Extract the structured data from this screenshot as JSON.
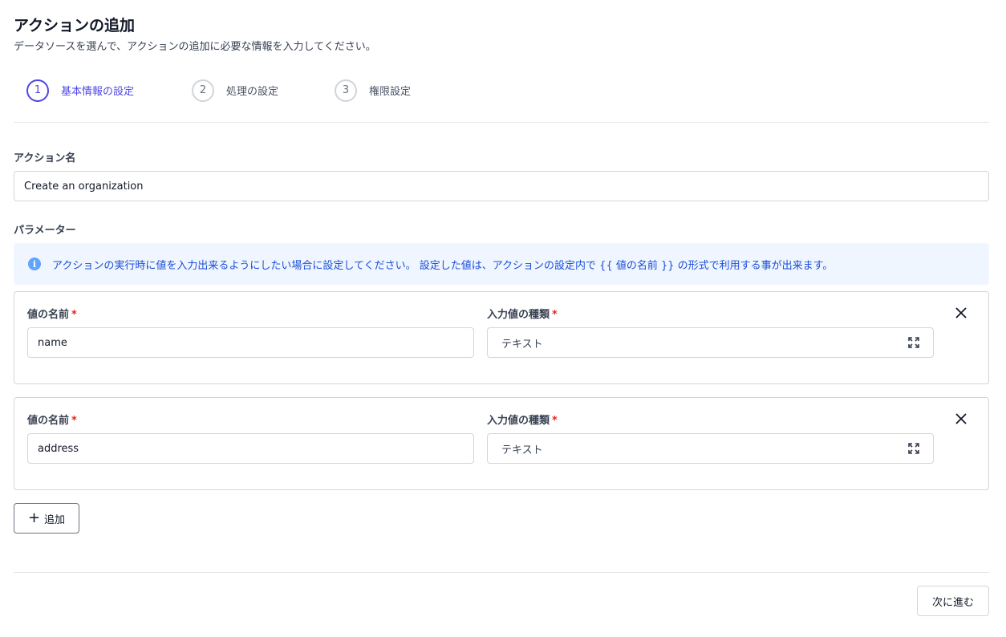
{
  "page": {
    "title": "アクションの追加",
    "subtitle": "データソースを選んで、アクションの追加に必要な情報を入力してください。"
  },
  "stepper": {
    "steps": [
      {
        "number": "1",
        "label": "基本情報の設定",
        "active": true
      },
      {
        "number": "2",
        "label": "処理の設定",
        "active": false
      },
      {
        "number": "3",
        "label": "権限設定",
        "active": false
      }
    ]
  },
  "action_name": {
    "label": "アクション名",
    "value": "Create an organization"
  },
  "parameters": {
    "label": "パラメーター",
    "info_text": "アクションの実行時に値を入力出来るようにしたい場合に設定してください。 設定した値は、アクションの設定内で {{ 値の名前 }} の形式で利用する事が出来ます。",
    "items": [
      {
        "name_label": "値の名前",
        "name_value": "name",
        "type_label": "入力値の種類",
        "type_value": "テキスト",
        "required_mark": "*"
      },
      {
        "name_label": "値の名前",
        "name_value": "address",
        "type_label": "入力値の種類",
        "type_value": "テキスト",
        "required_mark": "*"
      }
    ],
    "add_label": "追加"
  },
  "footer": {
    "next_label": "次に進む"
  },
  "colors": {
    "accent": "#4f46e5",
    "info_bg": "#eff6ff",
    "info_text": "#1d4ed8",
    "required": "#dc2626"
  },
  "icons": {
    "info": "info-icon",
    "remove": "close-icon",
    "select": "expand-icon",
    "add": "plus-icon"
  }
}
